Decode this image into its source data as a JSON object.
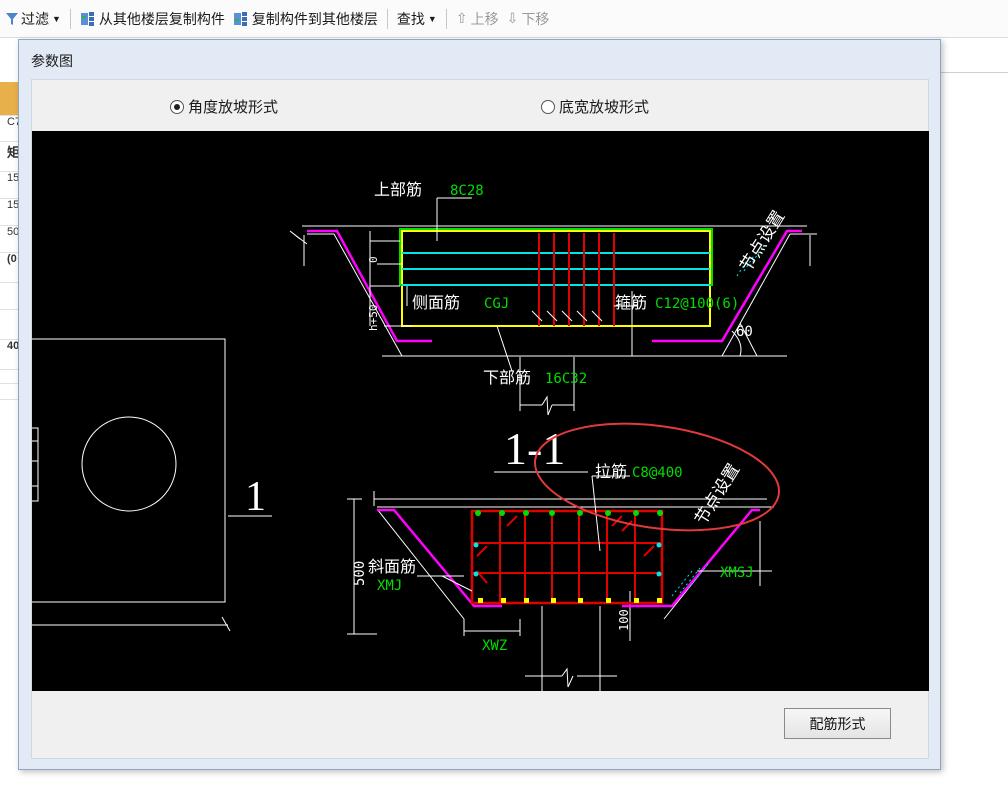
{
  "toolbar": {
    "filter_label": "过滤",
    "copy_from_label": "从其他楼层复制构件",
    "copy_to_label": "复制构件到其他楼层",
    "find_label": "查找",
    "move_up_label": "上移",
    "move_down_label": "下移"
  },
  "left_table": {
    "rows": [
      "C7",
      "矩",
      "15",
      "15",
      "50",
      "(0",
      "",
      "",
      "40",
      "",
      ""
    ]
  },
  "dialog": {
    "title": "参数图",
    "radio_angle": "角度放坡形式",
    "radio_width": "底宽放坡形式",
    "radio_selected": "angle",
    "config_button": "配筋形式"
  },
  "drawing": {
    "top_rebar_label": "上部筋",
    "top_rebar_value": "8C28",
    "side_rebar_label": "侧面筋",
    "side_rebar_value": "CGJ",
    "stirrup_label": "箍筋",
    "stirrup_value": "C12@100(6)",
    "bottom_rebar_label": "下部筋",
    "bottom_rebar_value": "16C32",
    "node_setting_label": "节点设置",
    "angle_value": "60",
    "dim_zero": "0",
    "dim_h": "h+50",
    "section_label": "1-1",
    "tie_label": "拉筋",
    "tie_value": "C8@400",
    "slope_rebar_label": "斜面筋",
    "slope_rebar_value": "XMJ",
    "dim_500": "500",
    "dim_100": "100",
    "xwz_label": "XWZ",
    "xmsj_label": "XMSJ",
    "plan_label": "1",
    "colors": {
      "background": "#000000",
      "lines": "#ffffff",
      "green": "#00dd00",
      "cyan": "#00e5e5",
      "red": "#e00000",
      "magenta": "#ff00ff",
      "yellow": "#ffff00",
      "annotation_ellipse": "#e23a3a"
    }
  }
}
